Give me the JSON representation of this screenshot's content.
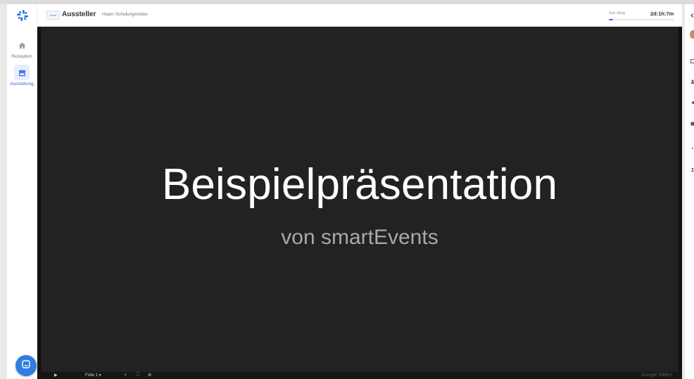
{
  "nav": {
    "items": [
      {
        "label": "Rezeption",
        "icon": "home-icon"
      },
      {
        "label": "Ausstellung",
        "icon": "booth-icon",
        "active": true
      }
    ]
  },
  "header": {
    "booth_logo_text": "smart Events",
    "title": "Aussteller",
    "subtitle": "Hopin Schulungsvideo",
    "time_label": "Zeit übrig",
    "time_value": "2d:1h:7m",
    "time_progress": 0.06
  },
  "slide": {
    "title": "Beispielpräsentation",
    "subtitle": "von smartEvents"
  },
  "player": {
    "play_icon": "play-icon",
    "slide_select": "Folie 1",
    "watermark": "Google Slides"
  },
  "colors": {
    "accent": "#2f6fdc",
    "slide_bg": "#222222",
    "chat_button": "#2f7de1"
  }
}
